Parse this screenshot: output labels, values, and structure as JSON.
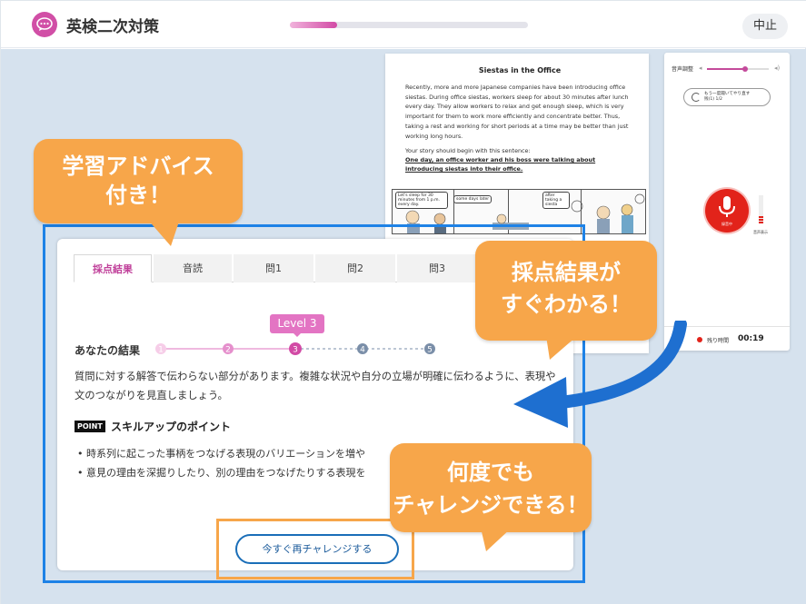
{
  "header": {
    "app_title": "英検二次対策",
    "progress_fraction": 0.2,
    "stop_label": "中止"
  },
  "document": {
    "title": "Siestas in the Office",
    "body": "Recently, more and more Japanese companies have been introducing office siestas. During office siestas, workers sleep for about 30 minutes after lunch every day. They allow workers to relax and get enough sleep, which is very important for them to work more efficiently and concentrate better. Thus, taking a rest and working for short periods at a time may be better than just working long hours.",
    "prompt": "Your story should begin with this sentence:",
    "start_sentence": "One day, an office worker and his boss were talking about introducing siestas into their office.",
    "comic_bubbles": [
      "Let's sleep for 30 minutes from 1 p.m. every day.",
      "some days later",
      "after taking a siesta"
    ]
  },
  "voice_panel": {
    "volume_label": "音声調整",
    "volume_fraction": 0.62,
    "retry_label": "もう一度聞いてやり直す",
    "retry_sub": "残(1) 1/2",
    "mic_label": "録音中",
    "level_label": "音声表示",
    "timer_label": "残り時間",
    "timer_value": "00:19"
  },
  "results": {
    "tabs": [
      {
        "label": "採点結果",
        "active": true
      },
      {
        "label": "音読",
        "active": false
      },
      {
        "label": "問1",
        "active": false
      },
      {
        "label": "問2",
        "active": false
      },
      {
        "label": "問3",
        "active": false
      }
    ],
    "level_badge": "Level 3",
    "steps": [
      "1",
      "2",
      "3",
      "4",
      "5"
    ],
    "current_level": 3,
    "result_label": "あなたの結果",
    "result_text": "質問に対する解答で伝わらない部分があります。複雑な状況や自分の立場が明確に伝わるように、表現や文のつながりを見直しましょう。",
    "point_badge": "POINT",
    "point_title": "スキルアップのポイント",
    "bullets": [
      "時系列に起こった事柄をつなげる表現のバリエーションを増や",
      "意見の理由を深掘りしたり、別の理由をつなげたりする表現を"
    ],
    "challenge_button": "今すぐ再チャレンジする"
  },
  "callouts": {
    "advice": [
      "学習アドバイス",
      "付き！"
    ],
    "instant": [
      "採点結果が",
      "すぐわかる！"
    ],
    "retry": [
      "何度でも",
      "チャレンジできる！"
    ]
  },
  "colors": {
    "accent_pink": "#d14fa6",
    "callout_orange": "#f7a64a",
    "frame_blue": "#1e82e6",
    "mic_red": "#e2231a"
  }
}
